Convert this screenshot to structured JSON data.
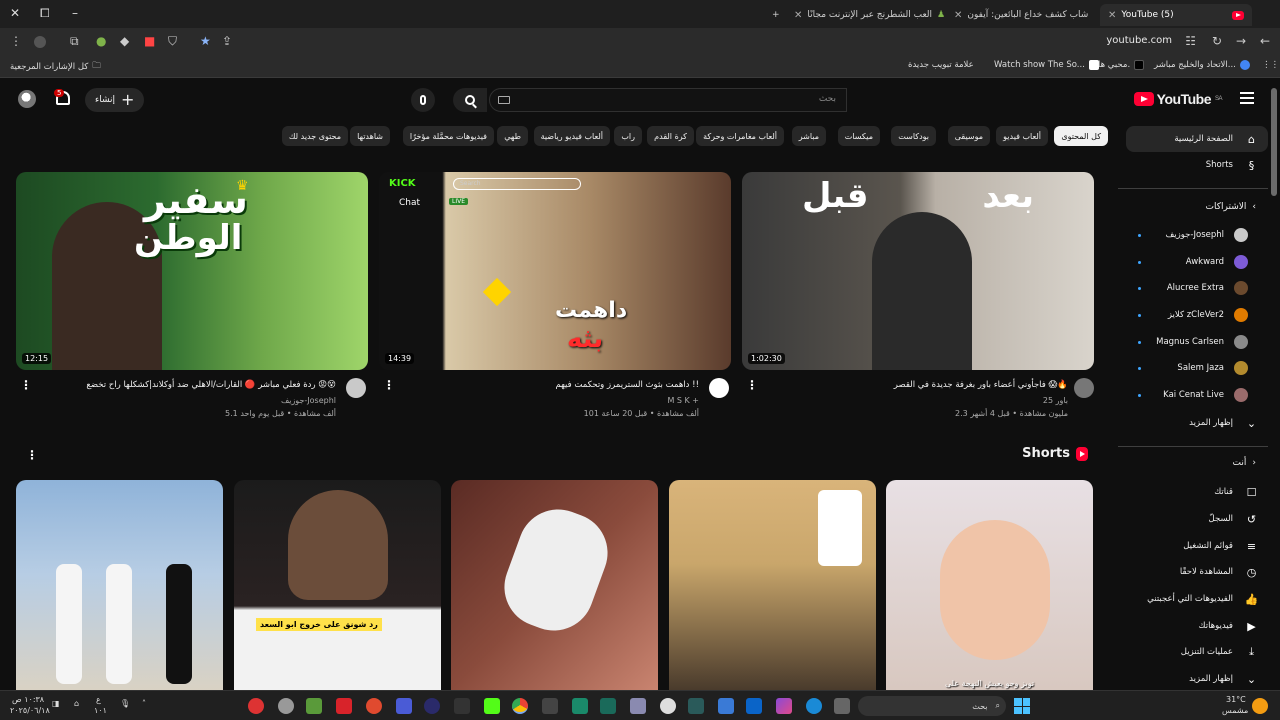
{
  "browser": {
    "tabs": [
      {
        "title": "YouTube (5)",
        "active": true
      },
      {
        "title": "شاب كشف خداع البائعين: آيفون",
        "active": false
      },
      {
        "title": "العب الشطرنج عبر الإنترنت مجانًا",
        "active": false
      }
    ],
    "url": "youtube.com",
    "bookmarks": [
      "كل الإشارات المرجعية",
      "علامة تبويب جديدة",
      "Watch show The So...",
      "محبي ها.",
      "الاتحاد والخليج مباشر..."
    ]
  },
  "header": {
    "logo": "YouTube",
    "region": "SA",
    "search_placeholder": "بحث",
    "create_label": "إنشاء",
    "notification_count": "5"
  },
  "chips": [
    "كل المحتوى",
    "ألعاب فيديو",
    "موسيقى",
    "بودكاست",
    "ميكسات",
    "مباشر",
    "ألعاب مغامرات وحركة",
    "كرة القدم",
    "راب",
    "ألعاب فيديو رياضية",
    "طهي",
    "فيديوهات محمَّلة مؤخرًا",
    "شاهدتها",
    "محتوى جديد لك"
  ],
  "sidebar": {
    "main": [
      {
        "label": "الصفحة الرئيسية",
        "icon": "home-icon"
      },
      {
        "label": "Shorts",
        "icon": "shorts-icon"
      }
    ],
    "subscriptions_title": "الاشتراكات",
    "subscriptions": [
      {
        "label": "جوزيف-Josephl",
        "color": "#c9c9c9"
      },
      {
        "label": "Awkward",
        "color": "#7d5bd6"
      },
      {
        "label": "Alucree Extra",
        "color": "#6b4a2e"
      },
      {
        "label": "كلايز zCleVer2",
        "color": "#e07b00"
      },
      {
        "label": "Magnus Carlsen",
        "color": "#8a8a8a"
      },
      {
        "label": "Salem Jaza",
        "color": "#b38b2e"
      },
      {
        "label": "Kai Cenat Live",
        "color": "#9a6b6b"
      }
    ],
    "show_more": "إظهار المزيد",
    "you_title": "أنت",
    "you_items": [
      {
        "label": "قناتك",
        "icon": "channel-icon",
        "glyph": "☐"
      },
      {
        "label": "السجلّ",
        "icon": "history-icon",
        "glyph": "↺"
      },
      {
        "label": "قوائم التشغيل",
        "icon": "playlist-icon",
        "glyph": "≡"
      },
      {
        "label": "المشاهدة لاحقًا",
        "icon": "clock-icon",
        "glyph": "◷"
      },
      {
        "label": "الفيديوهات التي أعجبتني",
        "icon": "like-icon",
        "glyph": "👍"
      },
      {
        "label": "فيديوهاتك",
        "icon": "your-videos-icon",
        "glyph": "▶"
      },
      {
        "label": "عمليات التنزيل",
        "icon": "download-icon",
        "glyph": "⤓"
      },
      {
        "label": "إظهار المزيد",
        "icon": "chevron-down-icon",
        "glyph": "⌄"
      }
    ]
  },
  "videos": [
    {
      "title": "فاجأوني أعضاء باور بغرفة جديدة في القصر 😱🔥",
      "channel": "باور 25",
      "meta": "2.3 مليون مشاهدة • قبل 4 أشهر",
      "duration": "1:02:30",
      "thumb_text_left": "قبل",
      "thumb_text_right": "بعد",
      "thumb_colors": [
        "#3a3a3a",
        "#b8b0a6"
      ]
    },
    {
      "title": "داهمت بثوث الستريمرز وتحكمت فيهم !!",
      "channel": "M S K +",
      "meta": "101 ألف مشاهدة • قبل 20 ساعة",
      "duration": "14:39",
      "thumb_text_1": "داهمت",
      "thumb_text_2": "بثه",
      "thumb_brand": "KICK",
      "thumb_chat": "Chat",
      "thumb_live": "LIVE",
      "thumb_search": "Search",
      "thumb_colors": [
        "#1a1a1a",
        "#d9c9a8"
      ]
    },
    {
      "title": "ردة فعلي مباشر 🔴 القارات/الاهلي ضد أوكلاند|كشكلها راح تخضع 😡😵",
      "channel": "جوزيف-Josephl",
      "meta": "5.1 ألف مشاهدة • قبل يوم واحد",
      "duration": "12:15",
      "thumb_text_1": "سفير",
      "thumb_text_2": "الوطن",
      "thumb_colors": [
        "#2c6b2f",
        "#9fd56a"
      ]
    }
  ],
  "shorts": {
    "title": "Shorts",
    "items": [
      {
        "caption": "توبز وجو يعيش النهجة على",
        "colors": [
          "#e8e0e4",
          "#d8c8c0"
        ]
      },
      {
        "caption": "",
        "colors": [
          "#c9a66b",
          "#4a3b2c"
        ]
      },
      {
        "caption": "",
        "colors": [
          "#5a2b24",
          "#c98470"
        ]
      },
      {
        "caption": "رد شونق على خروج ابو السعد",
        "colors": [
          "#1b1b1b",
          "#6b4d3a"
        ]
      },
      {
        "caption": "",
        "colors": [
          "#8fb3d9",
          "#d9d2c4"
        ]
      }
    ]
  },
  "taskbar": {
    "weather_temp": "31°C",
    "weather_desc": "مشمس",
    "search_label": "بحث",
    "time": "١٠:٣٨ ص",
    "date": "٢٠٢٥/٠٦/١٨",
    "lang": "ع",
    "lang_sub": "١٠١"
  }
}
